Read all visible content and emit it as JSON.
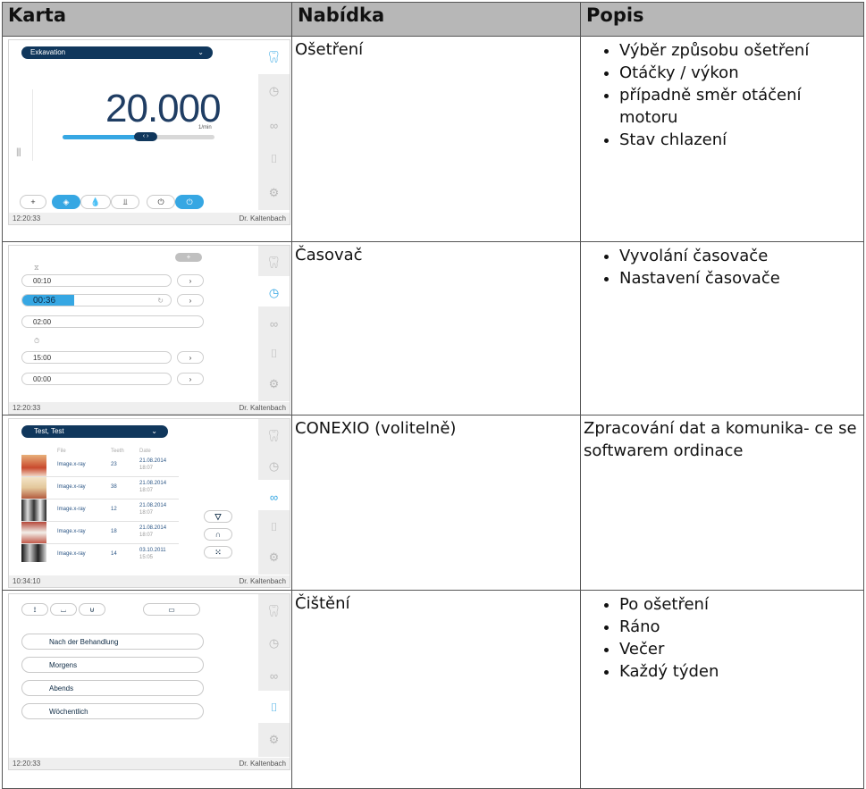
{
  "headers": [
    "Karta",
    "Nabídka",
    "Popis"
  ],
  "rows": [
    {
      "menu": "Ošetření",
      "bullets": [
        "Výběr způsobu ošetření",
        "Otáčky / výkon",
        "případně směr otáčení motoru",
        "Stav chlazení"
      ]
    },
    {
      "menu": "Časovač",
      "bullets": [
        "Vyvolání časovače",
        "Nastavení časovače"
      ]
    },
    {
      "menu": "CONEXIO (volitelně)",
      "desc": "Zpracování dat a komunika- ce se softwarem ordinace"
    },
    {
      "menu": "Čištění",
      "bullets": [
        "Po ošetření",
        "Ráno",
        "Večer",
        "Každý týden"
      ]
    }
  ],
  "panel1": {
    "dropdown": "Exkavation",
    "speed": "20.000",
    "unit": "1/min",
    "time": "12:20:33",
    "doctor": "Dr. Kaltenbach"
  },
  "panel2": {
    "timers": [
      "00:10",
      "00:36",
      "02:00",
      "15:00",
      "00:00"
    ],
    "time": "12:20:33",
    "doctor": "Dr. Kaltenbach"
  },
  "panel3": {
    "patient": "Test, Test",
    "col_file": "File",
    "col_teeth": "Teeth",
    "col_date": "Date",
    "files": [
      {
        "file": "Image.x-ray",
        "teeth": "23",
        "date": "21.08.2014",
        "time": "18:07"
      },
      {
        "file": "Image.x-ray",
        "teeth": "38",
        "date": "21.08.2014",
        "time": "18:07"
      },
      {
        "file": "Image.x-ray",
        "teeth": "12",
        "date": "21.08.2014",
        "time": "18:07"
      },
      {
        "file": "Image.x-ray",
        "teeth": "18",
        "date": "21.08.2014",
        "time": "18:07"
      },
      {
        "file": "Image.x-ray",
        "teeth": "14",
        "date": "03.10.2011",
        "time": "15:05"
      }
    ],
    "time": "10:34:10",
    "doctor": "Dr. Kaltenbach"
  },
  "panel4": {
    "options": [
      "Nach der Behandlung",
      "Morgens",
      "Abends",
      "Wöchentlich"
    ],
    "time": "12:20:33",
    "doctor": "Dr. Kaltenbach"
  },
  "colors": {
    "navy": "#10375c",
    "accent": "#36a7e3",
    "header_bg": "#b7b7b7"
  }
}
